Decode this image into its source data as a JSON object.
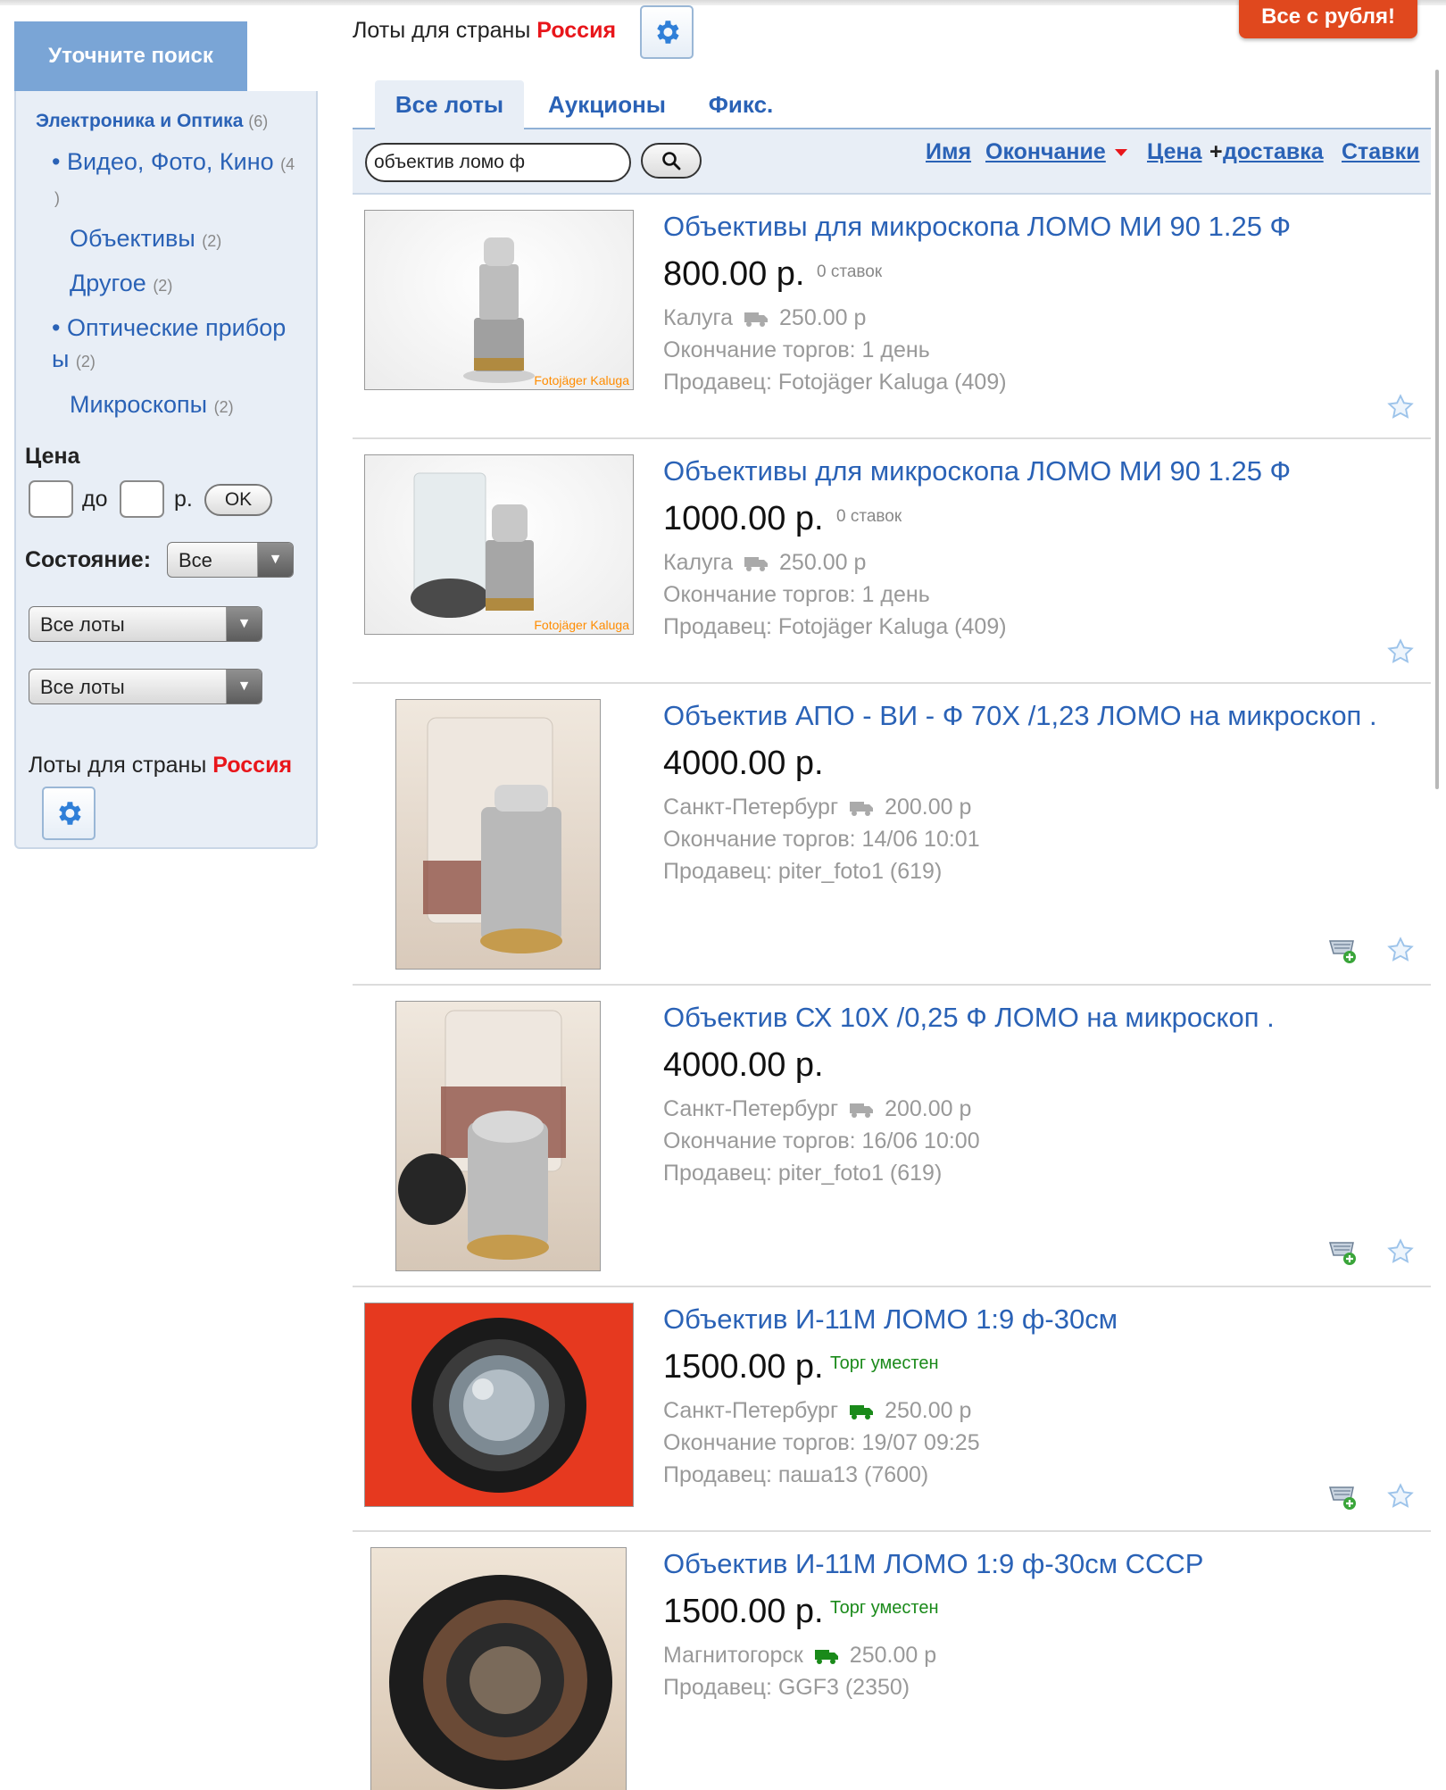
{
  "header": {
    "lots_for_country_prefix": "Лоты для страны",
    "country": "Россия",
    "rub_button": "Все с рубля!"
  },
  "sidebar": {
    "refine_title": "Уточните поиск",
    "root_category": {
      "label": "Электроника и Оптика",
      "count": "(6)"
    },
    "categories": [
      {
        "label": "Видео, Фото, Кино",
        "count": "(4",
        "count_tail": ")"
      },
      {
        "label": "Объективы",
        "count": "(2)"
      },
      {
        "label": "Другое",
        "count": "(2)"
      },
      {
        "label": "Оптические прибор",
        "label_tail": "ы",
        "count": "(2)"
      },
      {
        "label": "Микроскопы",
        "count": "(2)"
      }
    ],
    "price_label": "Цена",
    "price_to": "до",
    "price_currency": "р.",
    "ok_label": "OK",
    "condition_label": "Состояние:",
    "condition_value": "Все",
    "select1_value": "Все лоты",
    "select2_value": "Все лоты",
    "lots_for_country_prefix": "Лоты для страны",
    "country": "Россия"
  },
  "tabs": [
    {
      "label": "Все лоты",
      "active": true
    },
    {
      "label": "Аукционы",
      "active": false
    },
    {
      "label": "Фикс.",
      "active": false
    }
  ],
  "search": {
    "value": "объектив ломо ф"
  },
  "sort": {
    "name": "Имя",
    "ending": "Окончание",
    "price": "Цена",
    "plus": "+",
    "delivery": "доставка",
    "bids": "Ставки"
  },
  "listings": [
    {
      "title": "Объективы для микроскопа ЛОМО МИ 90 1.25 Ф",
      "price": "800.00 р.",
      "bids": "0 ставок",
      "city": "Калуга",
      "shipping": "250.00 р",
      "ending": "Окончание торгов: 1 день",
      "seller": "Продавец: Fotojäger Kaluga (409)",
      "watermark": "Fotojäger Kaluga",
      "cart": false
    },
    {
      "title": "Объективы для микроскопа ЛОМО МИ 90 1.25 Ф",
      "price": "1000.00 р.",
      "bids": "0 ставок",
      "city": "Калуга",
      "shipping": "250.00 р",
      "ending": "Окончание торгов: 1 день",
      "seller": "Продавец: Fotojäger Kaluga (409)",
      "watermark": "Fotojäger Kaluga",
      "cart": false
    },
    {
      "title": "Объектив АПО - ВИ - Ф 70Х /1,23 ЛОМО на микроскоп .",
      "price": "4000.00 р.",
      "city": "Санкт-Петербург",
      "shipping": "200.00 р",
      "ending": "Окончание торгов: 14/06 10:01",
      "seller": "Продавец: piter_foto1 (619)",
      "cart": true
    },
    {
      "title": "Объектив СХ 10Х /0,25 Ф ЛОМО на микроскоп .",
      "price": "4000.00 р.",
      "city": "Санкт-Петербург",
      "shipping": "200.00 р",
      "ending": "Окончание торгов: 16/06 10:00",
      "seller": "Продавец: piter_foto1 (619)",
      "cart": true
    },
    {
      "title": "Объектив И-11М ЛОМО 1:9 ф-30см",
      "price": "1500.00 р.",
      "bargain": "Торг уместен",
      "city": "Санкт-Петербург",
      "shipping": "250.00 р",
      "ending": "Окончание торгов: 19/07 09:25",
      "seller": "Продавец: паша13 (7600)",
      "cart": true
    },
    {
      "title": "Объектив И-11М ЛОМО 1:9 ф-30см СССР",
      "price": "1500.00 р.",
      "bargain": "Торг уместен",
      "city": "Магнитогорск",
      "shipping": "250.00 р",
      "seller": "Продавец: GGF3 (2350)",
      "cart": false
    }
  ],
  "colors": {
    "link": "#2a62b6",
    "country": "#e8161b",
    "accent_button": "#e0481e",
    "panel": "#e8eef6",
    "free_delivery_truck": "#1a8a1a"
  },
  "icons": [
    "gear-icon",
    "search-icon",
    "truck-icon",
    "star-icon",
    "cart-add-icon",
    "dropdown-arrow-icon"
  ]
}
